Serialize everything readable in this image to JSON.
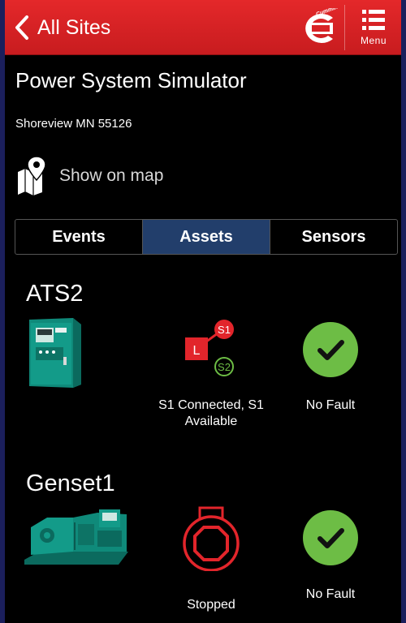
{
  "header": {
    "back_label": "All Sites",
    "logo_text": "Cummins",
    "menu_label": "Menu",
    "brand_color": "#d92326"
  },
  "site": {
    "title": "Power System Simulator",
    "address": "Shoreview MN 55126",
    "map_link": "Show on map"
  },
  "tabs": [
    {
      "label": "Events",
      "active": false
    },
    {
      "label": "Assets",
      "active": true
    },
    {
      "label": "Sensors",
      "active": false
    }
  ],
  "assets": [
    {
      "name": "ATS2",
      "thumbnail": "ats-cabinet-image",
      "status_icon": "transfer-switch-icon",
      "source_labels": {
        "load": "L",
        "s1": "S1",
        "s2": "S2"
      },
      "status_lines": [
        "S1 Connected, S1",
        "Available"
      ],
      "fault": "No Fault",
      "fault_icon": "check-circle-icon"
    },
    {
      "name": "Genset1",
      "thumbnail": "genset-image",
      "status_icon": "stop-icon",
      "status_lines": [
        "Stopped"
      ],
      "fault": "No Fault",
      "fault_icon": "check-circle-icon"
    }
  ],
  "colors": {
    "ok_green": "#6dbd45",
    "alert_red": "#e2252b",
    "active_tab": "#223e6b",
    "outer_border": "#1b1f5c"
  }
}
